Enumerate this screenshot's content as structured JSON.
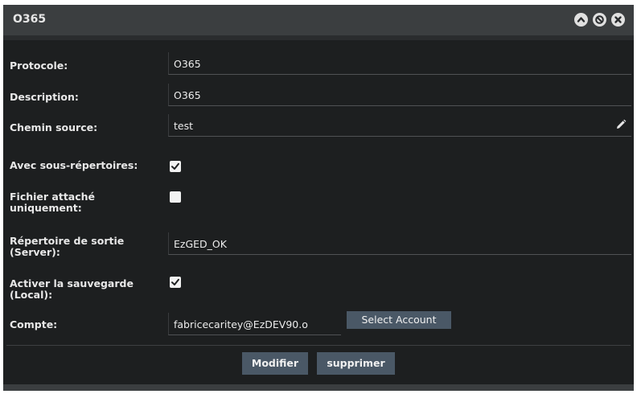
{
  "dialog": {
    "title": "O365",
    "controls": [
      "chevron-up-icon",
      "block-icon",
      "close-icon"
    ]
  },
  "form": {
    "protocole": {
      "label": "Protocole:",
      "value": "O365"
    },
    "description": {
      "label": "Description:",
      "value": "O365"
    },
    "chemin_source": {
      "label": "Chemin source:",
      "value": "test"
    },
    "avec_sous_repertoires": {
      "label": "Avec sous-répertoires:",
      "checked": true
    },
    "fichier_attache": {
      "label_line1": "Fichier attaché",
      "label_line2": "uniquement:",
      "checked": false
    },
    "repertoire_sortie": {
      "label_line1": "Répertoire de sortie",
      "label_line2": "(Server):",
      "value": "EzGED_OK"
    },
    "activer_sauvegarde": {
      "label_line1": "Activer la sauvegarde",
      "label_line2": "(Local):",
      "checked": true
    },
    "compte": {
      "label": "Compte:",
      "value": "fabricecaritey@EzDEV90.o",
      "select_label": "Select Account"
    }
  },
  "footer": {
    "modifier_label": "Modifier",
    "supprimer_label": "supprimer"
  },
  "colors": {
    "background": "#1d1f20",
    "titlebar": "#3b3e40",
    "button": "#4a5866",
    "text": "#e8e8e8"
  }
}
